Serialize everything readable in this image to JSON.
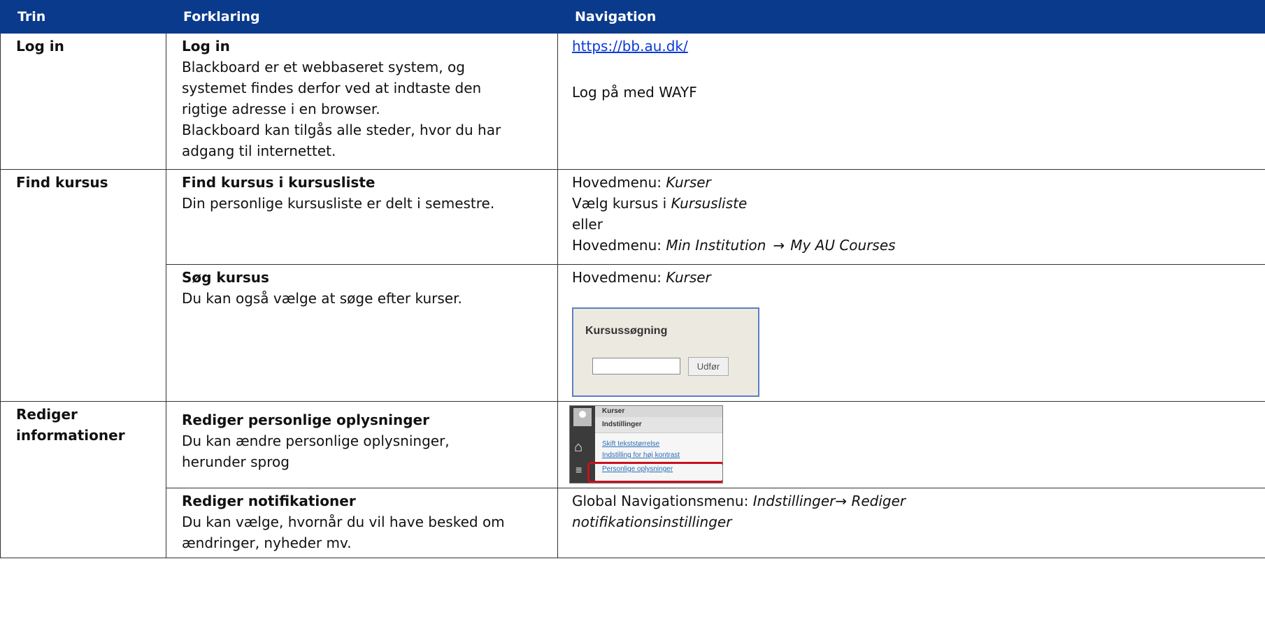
{
  "header": {
    "col1": "Trin",
    "col2": "Forklaring",
    "col3": "Navigation"
  },
  "rows": {
    "login": {
      "step": "Log in",
      "title": "Log in",
      "lines": [
        "Blackboard er et webbaseret system, og",
        "systemet findes derfor ved at indtaste den",
        "rigtige adresse i en browser.",
        "Blackboard kan tilgås alle steder, hvor du har",
        "adgang til internettet."
      ],
      "nav_link": "https://bb.au.dk/",
      "nav_text": "Log på med WAYF"
    },
    "find": {
      "step": "Find kursus",
      "title": "Find kursus i kursusliste",
      "desc": "Din personlige kursusliste er delt i semestre.",
      "nav1_prefix": "Hovedmenu: ",
      "nav1_italic": "Kurser",
      "nav2_prefix": "Vælg kursus i ",
      "nav2_italic": "Kursusliste",
      "nav3": "eller",
      "nav4_prefix": "Hovedmenu: ",
      "nav4_italic_a": "Min Institution",
      "nav4_arrow": "→",
      "nav4_italic_b": "My AU Courses"
    },
    "search": {
      "title": "Søg kursus",
      "desc": "Du kan også vælge at søge efter kurser.",
      "nav_prefix": "Hovedmenu: ",
      "nav_italic": "Kurser",
      "panel_title": "Kursussøgning",
      "panel_button": "Udfør"
    },
    "edit": {
      "step_line1": "Rediger",
      "step_line2": "informationer",
      "title": "Rediger personlige oplysninger",
      "desc_line1": "Du kan ændre personlige oplysninger,",
      "desc_line2": "herunder sprog",
      "menu_head1": "Kurser",
      "menu_head2": "Indstillinger",
      "menu_items": [
        "Skift tekststørrelse",
        "Indstilling for høj kontrast",
        "Personlige oplysninger"
      ]
    },
    "notif": {
      "title": "Rediger notifikationer",
      "desc_line1": "Du kan vælge, hvornår du vil have besked om",
      "desc_line2": "ændringer, nyheder mv.",
      "nav_prefix": "Global Navigationsmenu: ",
      "nav_italic_a": "Indstillinger",
      "nav_arrow": "→ ",
      "nav_italic_b1": "Rediger",
      "nav_italic_b2": "notifikationsinstillinger"
    }
  },
  "colors": {
    "header_bg": "#0a3a8c",
    "link": "#0b39d6",
    "highlight": "#c8101e"
  },
  "icons": [
    "avatar-icon",
    "home-icon",
    "stack-icon"
  ]
}
